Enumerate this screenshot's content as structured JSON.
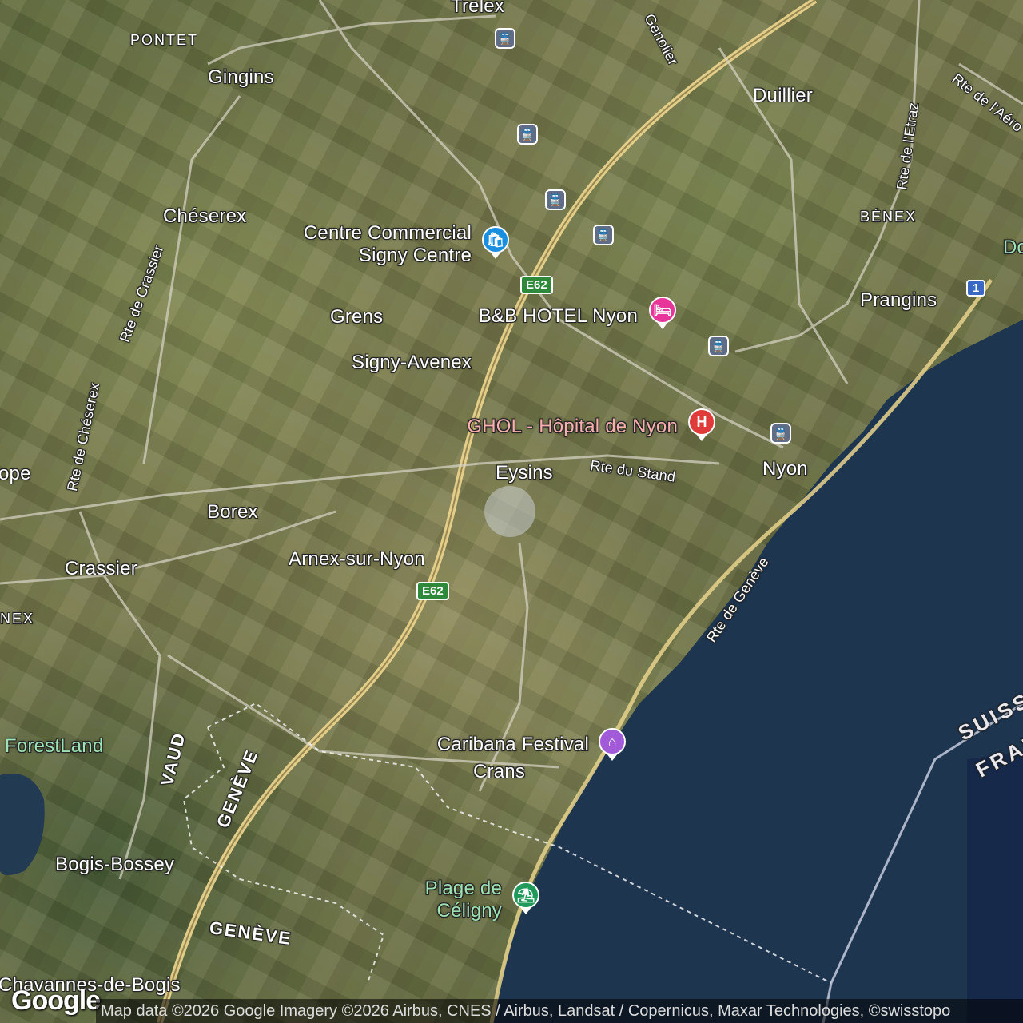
{
  "places": {
    "trelex": "Trelex",
    "genolier": "Genolier",
    "pontet": "PONTET",
    "gingins": "Gingins",
    "duillier": "Duillier",
    "rte_aer": "Rte de l'Aéro",
    "rte_etraz": "Rte de l'Etraz",
    "benex": "BÉNEX",
    "cheserex": "Chéserex",
    "prangins": "Prangins",
    "do": "Do",
    "rte_crassier": "Rte de Crassier",
    "grens": "Grens",
    "signy_avenex": "Signy-Avenex",
    "rte_cheserex": "Rte de Chéserex",
    "eysins": "Eysins",
    "rte_stand": "Rte du Stand",
    "nyon": "Nyon",
    "ope": "ope",
    "borex": "Borex",
    "crassier": "Crassier",
    "arnex": "Arnex-sur-Nyon",
    "nex": "NEX",
    "rte_geneve": "Rte de Genève",
    "suisse": "SUISSE",
    "franc": "FRANC",
    "forestland": "ForestLand",
    "vaud": "VAUD",
    "geneve_1": "GENÈVE",
    "crans": "Crans",
    "bogis": "Bogis-Bossey",
    "geneve_2": "GENÈVE",
    "chavannes": "Chavannes-de-Bogis"
  },
  "pois": {
    "signy_centre_1": "Centre Commercial",
    "signy_centre_2": "Signy Centre",
    "bb_hotel": "B&B HOTEL Nyon",
    "ghol": "GHOL - Hôpital de Nyon",
    "caribana": "Caribana Festival",
    "plage_1": "Plage de",
    "plage_2": "Céligny"
  },
  "shields": {
    "e62_north": "E62",
    "e62_south": "E62",
    "route_1": "1"
  },
  "colors": {
    "lake": "#1e3550",
    "poi_blue": "#1a8fe0",
    "poi_pink": "#e8359a",
    "poi_red": "#e03a3a",
    "poi_purple": "#a15ad8",
    "poi_green": "#1f9a5a",
    "highway": "#e8d28c"
  },
  "icons": {
    "shopping": "shopping-bag-icon",
    "hotel": "bed-icon",
    "hospital": "hospital-icon",
    "festival": "venue-icon",
    "beach": "beach-umbrella-icon",
    "train": "train-icon"
  },
  "branding": {
    "logo": "Google",
    "attribution": "Map data ©2026 Google Imagery ©2026 Airbus, CNES / Airbus, Landsat / Copernicus, Maxar Technologies, ©swisstopo"
  }
}
